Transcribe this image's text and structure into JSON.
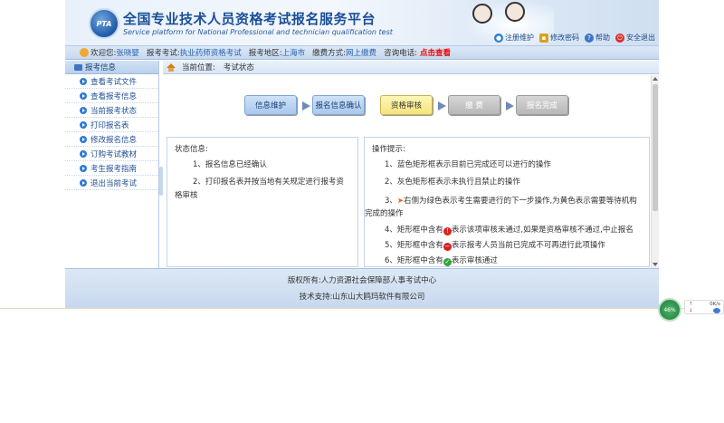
{
  "header": {
    "logo_text": "PTA",
    "title": "全国专业技术人员资格考试报名服务平台",
    "subtitle": "Service platform for National Professional and technician qualification test",
    "tools": [
      {
        "icon": "globe-icon",
        "label": "注册维护",
        "color": "#2a7fd0"
      },
      {
        "icon": "lock-icon",
        "label": "修改密码",
        "color": "#d8a21e"
      },
      {
        "icon": "help-icon",
        "label": "帮助",
        "color": "#3f74c6"
      },
      {
        "icon": "power-icon",
        "label": "安全退出",
        "color": "#d9302a"
      }
    ]
  },
  "infobar": {
    "welcome_label": "欢迎您:",
    "user_name": "张晓婴",
    "exam_label": "报考考试:",
    "exam_value": "执业药师资格考试",
    "region_label": "报考地区:",
    "region_value": "上海市",
    "pay_label": "缴费方式:",
    "pay_value": "网上缴费",
    "phone_label": "咨询电话:",
    "phone_link": "点击查看"
  },
  "sidebar": {
    "title": "报考信息",
    "items": [
      {
        "label": "查看考试文件"
      },
      {
        "label": "查看报考信息"
      },
      {
        "label": "当前报考状态"
      },
      {
        "label": "打印报名表"
      },
      {
        "label": "修改报名信息"
      },
      {
        "label": "订购考试教材"
      },
      {
        "label": "考生报考指南"
      },
      {
        "label": "退出当前考试"
      }
    ]
  },
  "breadcrumb": {
    "label": "当前位置:",
    "value": "考试状态"
  },
  "steps": [
    {
      "label": "信息维护",
      "state": "done"
    },
    {
      "label": "报名信息确认",
      "state": "done"
    },
    {
      "label": "资格审核",
      "state": "current"
    },
    {
      "label": "缴 费",
      "state": "disabled"
    },
    {
      "label": "报名完成",
      "state": "disabled"
    }
  ],
  "status_panel": {
    "title": "状态信息:",
    "lines": [
      "1、报名信息已经确认",
      "2、打印报名表并按当地有关规定进行报考资格审核"
    ]
  },
  "tips_panel": {
    "title": "操作提示:",
    "lines": [
      "1、蓝色矩形框表示目前已完成还可以进行的操作",
      "2、灰色矩形框表示未执行且禁止的操作",
      "3、",
      "右侧为绿色表示考生需要进行的下一步操作,为黄色表示需要等待机构完成的操作",
      "4、矩形框中含有",
      "表示该项审核未通过,如果是资格审核不通过,中止报名",
      "5、矩形框中含有",
      "表示报考人员当前已完成不可再进行此项操作",
      "6、矩形框中含有",
      "表示审核通过"
    ]
  },
  "footer": {
    "copyright": "版权所有:人力资源社会保障部人事考试中心",
    "support": "技术支持:山东山大鸥玛软件有限公司"
  },
  "tray": {
    "badge_text": "46%",
    "up_speed": "↑",
    "down_speed": "↓",
    "speed_value": "0K/s"
  }
}
